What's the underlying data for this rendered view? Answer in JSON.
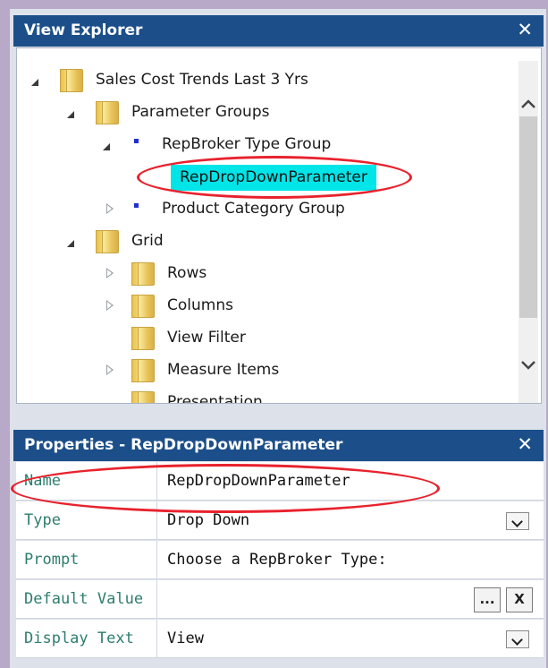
{
  "view_explorer": {
    "title": "View Explorer",
    "close": "✕",
    "tree": {
      "root": "Sales Cost Trends Last 3 Yrs",
      "parameter_groups": "Parameter Groups",
      "rep_group": "RepBroker Type Group",
      "selected_parameter": "RepDropDownParameter",
      "product_group": "Product Category Group",
      "grid": "Grid",
      "rows": "Rows",
      "columns": "Columns",
      "view_filter": "View Filter",
      "measure_items": "Measure Items",
      "presentation": "Presentation"
    }
  },
  "properties": {
    "title": "Properties - RepDropDownParameter",
    "close": "✕",
    "rows": [
      {
        "name": "Name",
        "value": "RepDropDownParameter"
      },
      {
        "name": "Type",
        "value": "Drop Down"
      },
      {
        "name": "Prompt",
        "value": "Choose a RepBroker Type:"
      },
      {
        "name": "Default Value",
        "value": ""
      },
      {
        "name": "Display Text",
        "value": "View"
      }
    ],
    "ellipsis_label": "...",
    "clear_label": "X"
  },
  "colors": {
    "title_bar": "#1c4f8a",
    "selection": "#00e5e8",
    "highlight_ring": "#e8222d",
    "property_name": "#2e7d6e"
  }
}
